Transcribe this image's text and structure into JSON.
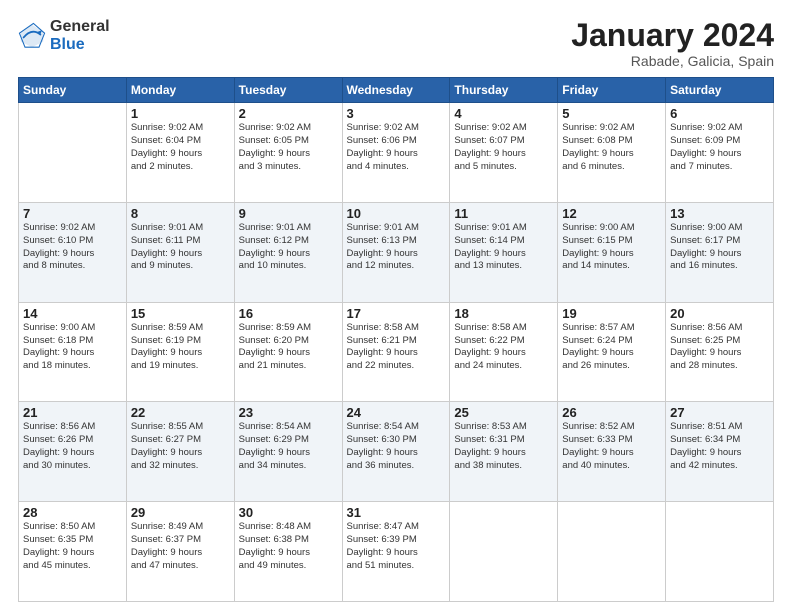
{
  "logo": {
    "general": "General",
    "blue": "Blue"
  },
  "header": {
    "month": "January 2024",
    "location": "Rabade, Galicia, Spain"
  },
  "days_of_week": [
    "Sunday",
    "Monday",
    "Tuesday",
    "Wednesday",
    "Thursday",
    "Friday",
    "Saturday"
  ],
  "weeks": [
    [
      {
        "day": "",
        "info": ""
      },
      {
        "day": "1",
        "info": "Sunrise: 9:02 AM\nSunset: 6:04 PM\nDaylight: 9 hours\nand 2 minutes."
      },
      {
        "day": "2",
        "info": "Sunrise: 9:02 AM\nSunset: 6:05 PM\nDaylight: 9 hours\nand 3 minutes."
      },
      {
        "day": "3",
        "info": "Sunrise: 9:02 AM\nSunset: 6:06 PM\nDaylight: 9 hours\nand 4 minutes."
      },
      {
        "day": "4",
        "info": "Sunrise: 9:02 AM\nSunset: 6:07 PM\nDaylight: 9 hours\nand 5 minutes."
      },
      {
        "day": "5",
        "info": "Sunrise: 9:02 AM\nSunset: 6:08 PM\nDaylight: 9 hours\nand 6 minutes."
      },
      {
        "day": "6",
        "info": "Sunrise: 9:02 AM\nSunset: 6:09 PM\nDaylight: 9 hours\nand 7 minutes."
      }
    ],
    [
      {
        "day": "7",
        "info": "Sunrise: 9:02 AM\nSunset: 6:10 PM\nDaylight: 9 hours\nand 8 minutes."
      },
      {
        "day": "8",
        "info": "Sunrise: 9:01 AM\nSunset: 6:11 PM\nDaylight: 9 hours\nand 9 minutes."
      },
      {
        "day": "9",
        "info": "Sunrise: 9:01 AM\nSunset: 6:12 PM\nDaylight: 9 hours\nand 10 minutes."
      },
      {
        "day": "10",
        "info": "Sunrise: 9:01 AM\nSunset: 6:13 PM\nDaylight: 9 hours\nand 12 minutes."
      },
      {
        "day": "11",
        "info": "Sunrise: 9:01 AM\nSunset: 6:14 PM\nDaylight: 9 hours\nand 13 minutes."
      },
      {
        "day": "12",
        "info": "Sunrise: 9:00 AM\nSunset: 6:15 PM\nDaylight: 9 hours\nand 14 minutes."
      },
      {
        "day": "13",
        "info": "Sunrise: 9:00 AM\nSunset: 6:17 PM\nDaylight: 9 hours\nand 16 minutes."
      }
    ],
    [
      {
        "day": "14",
        "info": "Sunrise: 9:00 AM\nSunset: 6:18 PM\nDaylight: 9 hours\nand 18 minutes."
      },
      {
        "day": "15",
        "info": "Sunrise: 8:59 AM\nSunset: 6:19 PM\nDaylight: 9 hours\nand 19 minutes."
      },
      {
        "day": "16",
        "info": "Sunrise: 8:59 AM\nSunset: 6:20 PM\nDaylight: 9 hours\nand 21 minutes."
      },
      {
        "day": "17",
        "info": "Sunrise: 8:58 AM\nSunset: 6:21 PM\nDaylight: 9 hours\nand 22 minutes."
      },
      {
        "day": "18",
        "info": "Sunrise: 8:58 AM\nSunset: 6:22 PM\nDaylight: 9 hours\nand 24 minutes."
      },
      {
        "day": "19",
        "info": "Sunrise: 8:57 AM\nSunset: 6:24 PM\nDaylight: 9 hours\nand 26 minutes."
      },
      {
        "day": "20",
        "info": "Sunrise: 8:56 AM\nSunset: 6:25 PM\nDaylight: 9 hours\nand 28 minutes."
      }
    ],
    [
      {
        "day": "21",
        "info": "Sunrise: 8:56 AM\nSunset: 6:26 PM\nDaylight: 9 hours\nand 30 minutes."
      },
      {
        "day": "22",
        "info": "Sunrise: 8:55 AM\nSunset: 6:27 PM\nDaylight: 9 hours\nand 32 minutes."
      },
      {
        "day": "23",
        "info": "Sunrise: 8:54 AM\nSunset: 6:29 PM\nDaylight: 9 hours\nand 34 minutes."
      },
      {
        "day": "24",
        "info": "Sunrise: 8:54 AM\nSunset: 6:30 PM\nDaylight: 9 hours\nand 36 minutes."
      },
      {
        "day": "25",
        "info": "Sunrise: 8:53 AM\nSunset: 6:31 PM\nDaylight: 9 hours\nand 38 minutes."
      },
      {
        "day": "26",
        "info": "Sunrise: 8:52 AM\nSunset: 6:33 PM\nDaylight: 9 hours\nand 40 minutes."
      },
      {
        "day": "27",
        "info": "Sunrise: 8:51 AM\nSunset: 6:34 PM\nDaylight: 9 hours\nand 42 minutes."
      }
    ],
    [
      {
        "day": "28",
        "info": "Sunrise: 8:50 AM\nSunset: 6:35 PM\nDaylight: 9 hours\nand 45 minutes."
      },
      {
        "day": "29",
        "info": "Sunrise: 8:49 AM\nSunset: 6:37 PM\nDaylight: 9 hours\nand 47 minutes."
      },
      {
        "day": "30",
        "info": "Sunrise: 8:48 AM\nSunset: 6:38 PM\nDaylight: 9 hours\nand 49 minutes."
      },
      {
        "day": "31",
        "info": "Sunrise: 8:47 AM\nSunset: 6:39 PM\nDaylight: 9 hours\nand 51 minutes."
      },
      {
        "day": "",
        "info": ""
      },
      {
        "day": "",
        "info": ""
      },
      {
        "day": "",
        "info": ""
      }
    ]
  ]
}
